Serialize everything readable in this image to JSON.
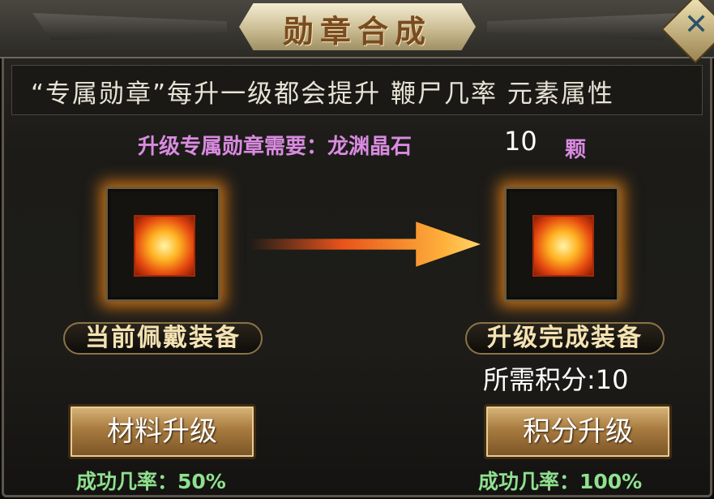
{
  "window": {
    "title": "勋章合成",
    "close_icon": "close-x-icon"
  },
  "description": "“专属勋章”每升一级都会提升 鞭尸几率 元素属性",
  "requirement": {
    "label": "升级专属勋章需要：龙渊晶石",
    "amount": "10",
    "unit": "颗"
  },
  "current_equipment": {
    "label": "当前佩戴装备",
    "icon": "flame-medal-icon"
  },
  "result_equipment": {
    "label": "升级完成装备",
    "icon": "flame-medal-upgraded-icon"
  },
  "points_cost": "所需积分:10",
  "material_upgrade": {
    "button_label": "材料升级",
    "success_rate": "成功几率：50%"
  },
  "points_upgrade": {
    "button_label": "积分升级",
    "success_rate": "成功几率：100%"
  },
  "colors": {
    "title": "#7a4b20",
    "requirement": "#d98be0",
    "success_rate": "#8fe08f",
    "button": "#a87b3f"
  }
}
